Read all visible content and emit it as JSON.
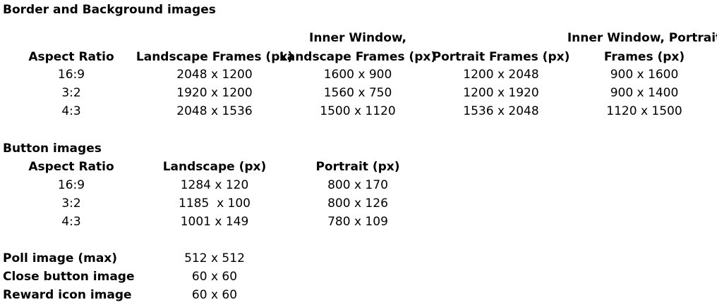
{
  "border_section": {
    "title": "Border and Background images",
    "headers": {
      "aspect_ratio": "Aspect Ratio",
      "landscape": "Landscape Frames (px)",
      "inner_landscape_l1": "Inner Window,",
      "inner_landscape_l2": "Landscape Frames (px)",
      "portrait": "Portrait Frames (px)",
      "inner_portrait_l1": "Inner Window, Portrait",
      "inner_portrait_l2": "Frames (px)"
    },
    "rows": [
      {
        "ratio": "16:9",
        "landscape": "2048 x 1200",
        "inner_landscape": "1600 x 900",
        "portrait": "1200 x 2048",
        "inner_portrait": "900 x 1600"
      },
      {
        "ratio": "3:2",
        "landscape": "1920 x 1200",
        "inner_landscape": "1560 x 750",
        "portrait": "1200 x 1920",
        "inner_portrait": "900 x 1400"
      },
      {
        "ratio": "4:3",
        "landscape": "2048 x 1536",
        "inner_landscape": "1500 x 1120",
        "portrait": "1536 x 2048",
        "inner_portrait": "1120 x 1500"
      }
    ]
  },
  "button_section": {
    "title": "Button images",
    "headers": {
      "aspect_ratio": "Aspect Ratio",
      "landscape": "Landscape (px)",
      "portrait": "Portrait (px)"
    },
    "rows": [
      {
        "ratio": "16:9",
        "landscape": "1284 x 120",
        "portrait": "800 x 170"
      },
      {
        "ratio": "3:2",
        "landscape": "1185  x 100",
        "portrait": "800 x 126"
      },
      {
        "ratio": "4:3",
        "landscape": "1001 x 149",
        "portrait": "780 x 109"
      }
    ]
  },
  "misc": [
    {
      "label": "Poll image (max)",
      "value": "512 x 512"
    },
    {
      "label": "Close button image",
      "value": "60 x 60"
    },
    {
      "label": "Reward icon image",
      "value": "60 x 60"
    }
  ]
}
